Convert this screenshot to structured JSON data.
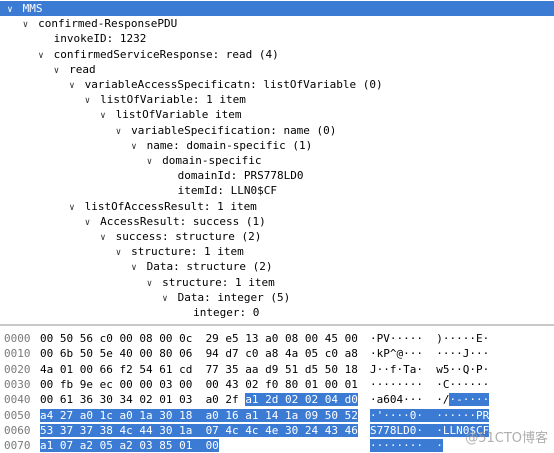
{
  "tree": [
    {
      "label": "MMS",
      "indent": 0,
      "arrow": "down",
      "selected": true
    },
    {
      "label": "confirmed-ResponsePDU",
      "indent": 1,
      "arrow": "down"
    },
    {
      "label": "invokeID: 1232",
      "indent": 2,
      "arrow": ""
    },
    {
      "label": "confirmedServiceResponse: read (4)",
      "indent": 2,
      "arrow": "down"
    },
    {
      "label": "read",
      "indent": 3,
      "arrow": "down"
    },
    {
      "label": "variableAccessSpecificatn: listOfVariable (0)",
      "indent": 4,
      "arrow": "down"
    },
    {
      "label": "listOfVariable: 1 item",
      "indent": 5,
      "arrow": "down"
    },
    {
      "label": "listOfVariable item",
      "indent": 6,
      "arrow": "down"
    },
    {
      "label": "variableSpecification: name (0)",
      "indent": 7,
      "arrow": "down"
    },
    {
      "label": "name: domain-specific (1)",
      "indent": 8,
      "arrow": "down"
    },
    {
      "label": "domain-specific",
      "indent": 9,
      "arrow": "down"
    },
    {
      "label": "domainId: PRS778LD0",
      "indent": 10,
      "arrow": ""
    },
    {
      "label": "itemId: LLN0$CF",
      "indent": 10,
      "arrow": ""
    },
    {
      "label": "listOfAccessResult: 1 item",
      "indent": 4,
      "arrow": "down"
    },
    {
      "label": "AccessResult: success (1)",
      "indent": 5,
      "arrow": "down"
    },
    {
      "label": "success: structure (2)",
      "indent": 6,
      "arrow": "down"
    },
    {
      "label": "structure: 1 item",
      "indent": 7,
      "arrow": "down"
    },
    {
      "label": "Data: structure (2)",
      "indent": 8,
      "arrow": "down"
    },
    {
      "label": "structure: 1 item",
      "indent": 9,
      "arrow": "down"
    },
    {
      "label": "Data: integer (5)",
      "indent": 10,
      "arrow": "down"
    },
    {
      "label": "integer: 0",
      "indent": 11,
      "arrow": ""
    }
  ],
  "hex": [
    {
      "offset": "0000",
      "bytes": "00 50 56 c0 00 08 00 0c  29 e5 13 a0 08 00 45 00",
      "ascii": "·PV·····  )·····E·",
      "hl_from": -1
    },
    {
      "offset": "0010",
      "bytes": "00 6b 50 5e 40 00 80 06  94 d7 c0 a8 4a 05 c0 a8",
      "ascii": "·kP^@···  ····J···",
      "hl_from": -1
    },
    {
      "offset": "0020",
      "bytes": "4a 01 00 66 f2 54 61 cd  77 35 aa d9 51 d5 50 18",
      "ascii": "J··f·Ta·  w5··Q·P·",
      "hl_from": -1
    },
    {
      "offset": "0030",
      "bytes": "00 fb 9e ec 00 00 03 00  00 43 02 f0 80 01 00 01",
      "ascii": "········  ·C······",
      "hl_from": -1
    },
    {
      "offset": "0040",
      "bytes": "00 61 36 30 34 02 01 03  a0 2f a1 2d 02 02 04 d0",
      "ascii": "·a604···  ·/·-····",
      "hl_from": 10
    },
    {
      "offset": "0050",
      "bytes": "a4 27 a0 1c a0 1a 30 18  a0 16 a1 14 1a 09 50 52",
      "ascii": "·'····0·  ······PR",
      "hl_from": 0
    },
    {
      "offset": "0060",
      "bytes": "53 37 37 38 4c 44 30 1a  07 4c 4c 4e 30 24 43 46",
      "ascii": "S778LD0·  ·LLN0$CF",
      "hl_from": 0
    },
    {
      "offset": "0070",
      "bytes": "a1 07 a2 05 a2 03 85 01  00",
      "ascii": "········  ·",
      "hl_from": 0
    }
  ],
  "watermark": "@51CTO博客"
}
